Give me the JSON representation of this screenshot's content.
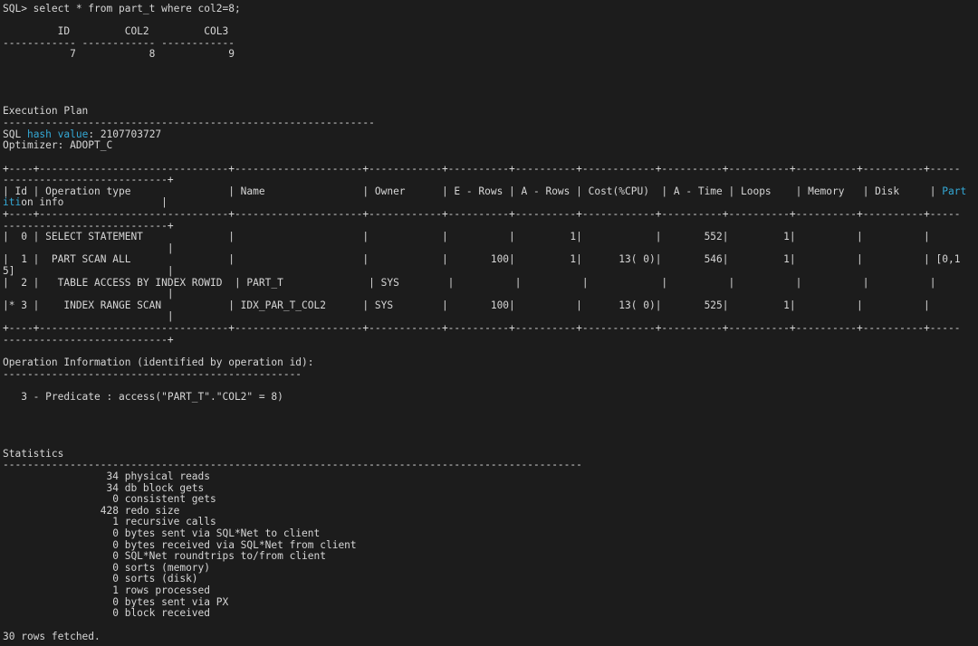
{
  "terminal": {
    "lines": [
      "SQL> select * from part_t where col2=8;",
      "",
      "         ID         COL2         COL3",
      "------------ ------------ ------------",
      "           7            8            9",
      "",
      "",
      "",
      "",
      "Execution Plan",
      "-------------------------------------------------------------",
      "SQL hash value: 2107703727",
      "Optimizer: ADOPT_C",
      "",
      "+----+-------------------------------+---------------------+------------+----------+----------+------------+----------+----------+----------+----------+-----",
      "---------------------------+",
      "| Id | Operation type                | Name                | Owner      | E - Rows | A - Rows | Cost(%CPU)  | A - Time | Loops    | Memory   | Disk     | Part",
      "ition info                |",
      "+----+-------------------------------+---------------------+------------+----------+----------+------------+----------+----------+----------+----------+-----",
      "---------------------------+",
      "|  0 | SELECT STATEMENT              |                     |            |          |         1|            |       552|         1|          |          |",
      "                           |",
      "|  1 |  PART SCAN ALL                |                     |            |       100|         1|      13( 0)|       546|         1|          |          | [0,1",
      "5]                         |",
      "|  2 |   TABLE ACCESS BY INDEX ROWID  | PART_T              | SYS        |          |          |            |          |          |          |          |",
      "                           |",
      "|* 3 |    INDEX RANGE SCAN           | IDX_PAR_T_COL2      | SYS        |       100|          |      13( 0)|       525|         1|          |          |",
      "                           |",
      "+----+-------------------------------+---------------------+------------+----------+----------+------------+----------+----------+----------+----------+-----",
      "---------------------------+",
      "",
      "Operation Information (identified by operation id):",
      "-------------------------------------------------",
      "",
      "   3 - Predicate : access(\"PART_T\".\"COL2\" = 8)",
      "",
      "",
      "",
      "",
      "Statistics",
      "-----------------------------------------------------------------------------------------------",
      "                 34 physical reads",
      "                 34 db block gets",
      "                  0 consistent gets",
      "                428 redo size",
      "                  1 recursive calls",
      "                  0 bytes sent via SQL*Net to client",
      "                  0 bytes received via SQL*Net from client",
      "                  0 SQL*Net roundtrips to/from client",
      "                  0 sorts (memory)",
      "                  0 sorts (disk)",
      "                  1 rows processed",
      "                  0 bytes sent via PX",
      "                  0 block received",
      "",
      "30 rows fetched."
    ],
    "highlight_color": "#34a9d6"
  }
}
